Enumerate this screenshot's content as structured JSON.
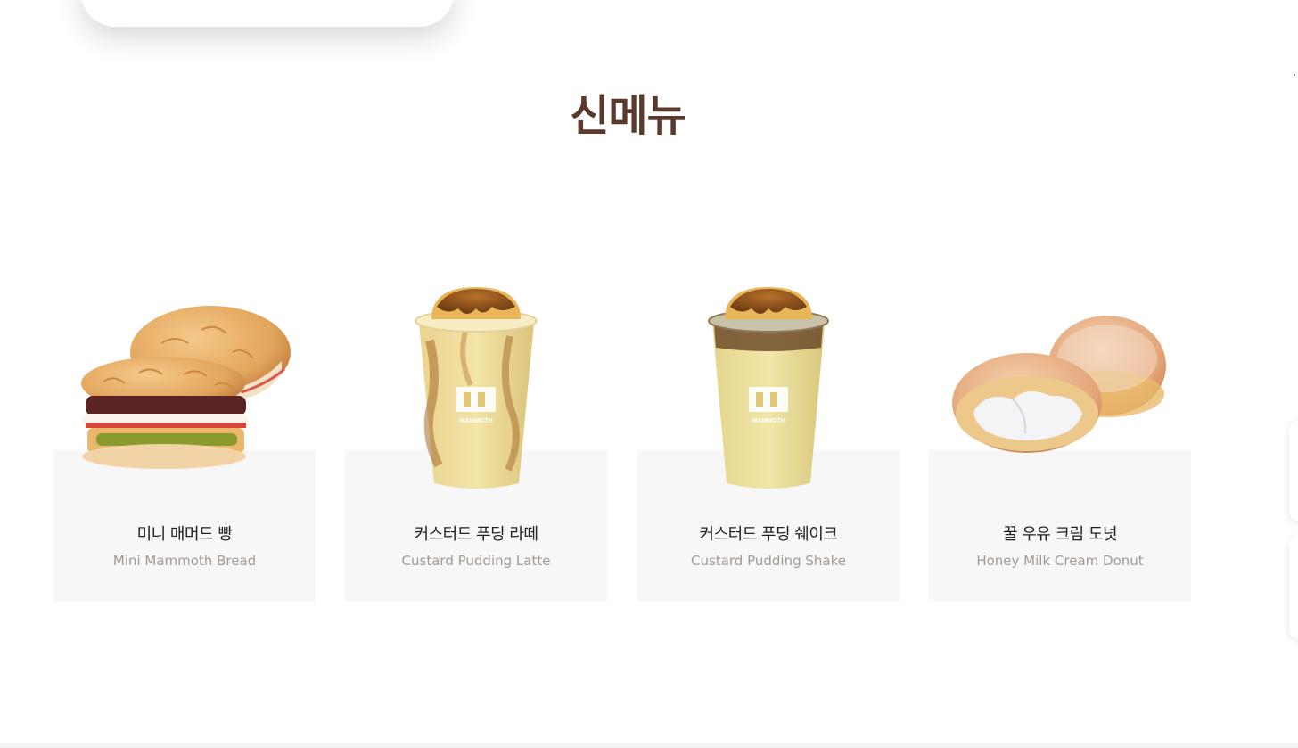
{
  "section": {
    "title": "신메뉴"
  },
  "products": [
    {
      "name_ko": "미니 매머드 빵",
      "name_en": "Mini Mammoth Bread",
      "image_icon": "bread-icon"
    },
    {
      "name_ko": "커스터드 푸딩 라떼",
      "name_en": "Custard Pudding Latte",
      "image_icon": "latte-cup-icon"
    },
    {
      "name_ko": "커스터드 푸딩 쉐이크",
      "name_en": "Custard Pudding Shake",
      "image_icon": "shake-cup-icon"
    },
    {
      "name_ko": "꿀 우유 크림 도넛",
      "name_en": "Honey Milk Cream Donut",
      "image_icon": "donut-icon"
    }
  ],
  "cup_logo_text": "MAMMOTH",
  "colors": {
    "title": "#5a3a2d",
    "card_bg": "#f7f7f7",
    "en_text": "#a39a94"
  }
}
